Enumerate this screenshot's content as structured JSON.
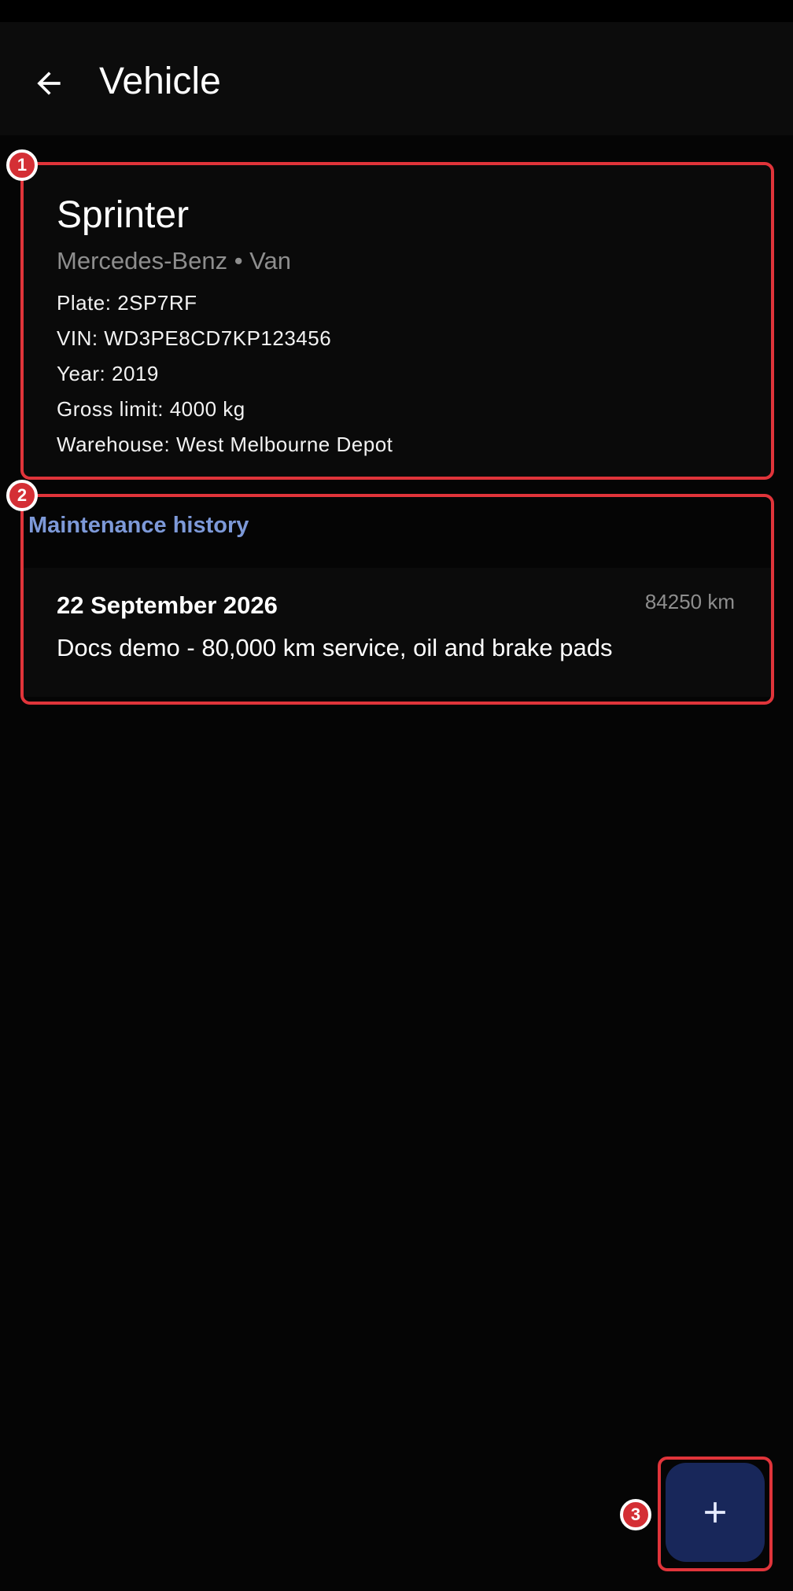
{
  "app_bar": {
    "title": "Vehicle",
    "back_icon": "arrow-left-icon"
  },
  "vehicle": {
    "name": "Sprinter",
    "subtitle": "Mercedes-Benz • Van",
    "details": {
      "plate": "Plate: 2SP7RF",
      "vin": "VIN: WD3PE8CD7KP123456",
      "year": "Year: 2019",
      "gross_limit": "Gross limit: 4000 kg",
      "warehouse": "Warehouse: West Melbourne Depot"
    }
  },
  "maintenance": {
    "header": "Maintenance history",
    "items": [
      {
        "date": "22 September 2026",
        "odometer": "84250 km",
        "description": "Docs demo - 80,000 km service, oil and brake pads"
      }
    ]
  },
  "fab": {
    "icon": "plus-icon"
  },
  "annotations": [
    "1",
    "2",
    "3"
  ],
  "colors": {
    "background": "#050505",
    "app_bar": "#0c0c0c",
    "accent": "#7d99d8",
    "fab": "#18275a",
    "annotation": "#e0343a"
  }
}
